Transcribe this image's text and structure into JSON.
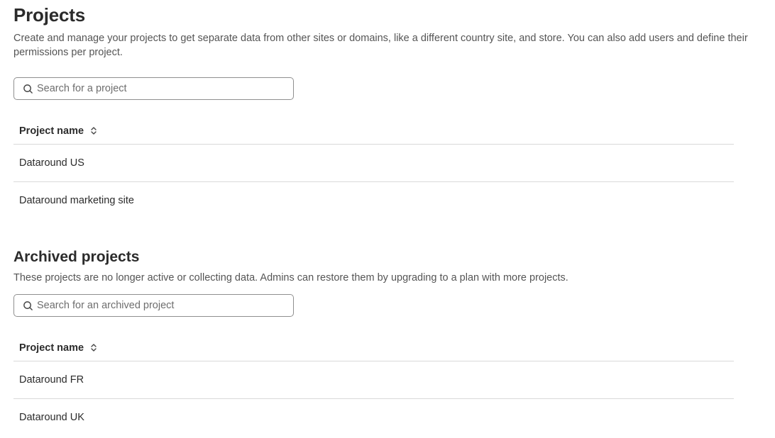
{
  "projects": {
    "title": "Projects",
    "description": "Create and manage your projects to get separate data from other sites or domains, like a different country site, and store. You can also add users and define their permissions per project.",
    "search_placeholder": "Search for a project",
    "column_header": "Project name",
    "rows": [
      "Dataround US",
      "Dataround marketing site"
    ]
  },
  "archived": {
    "title": "Archived projects",
    "description": "These projects are no longer active or collecting data. Admins can restore them by upgrading to a plan with more projects.",
    "search_placeholder": "Search for an archived project",
    "column_header": "Project name",
    "rows": [
      "Dataround FR",
      "Dataround UK"
    ]
  },
  "icons": {
    "search": "search-icon",
    "sort": "sort-icon"
  }
}
